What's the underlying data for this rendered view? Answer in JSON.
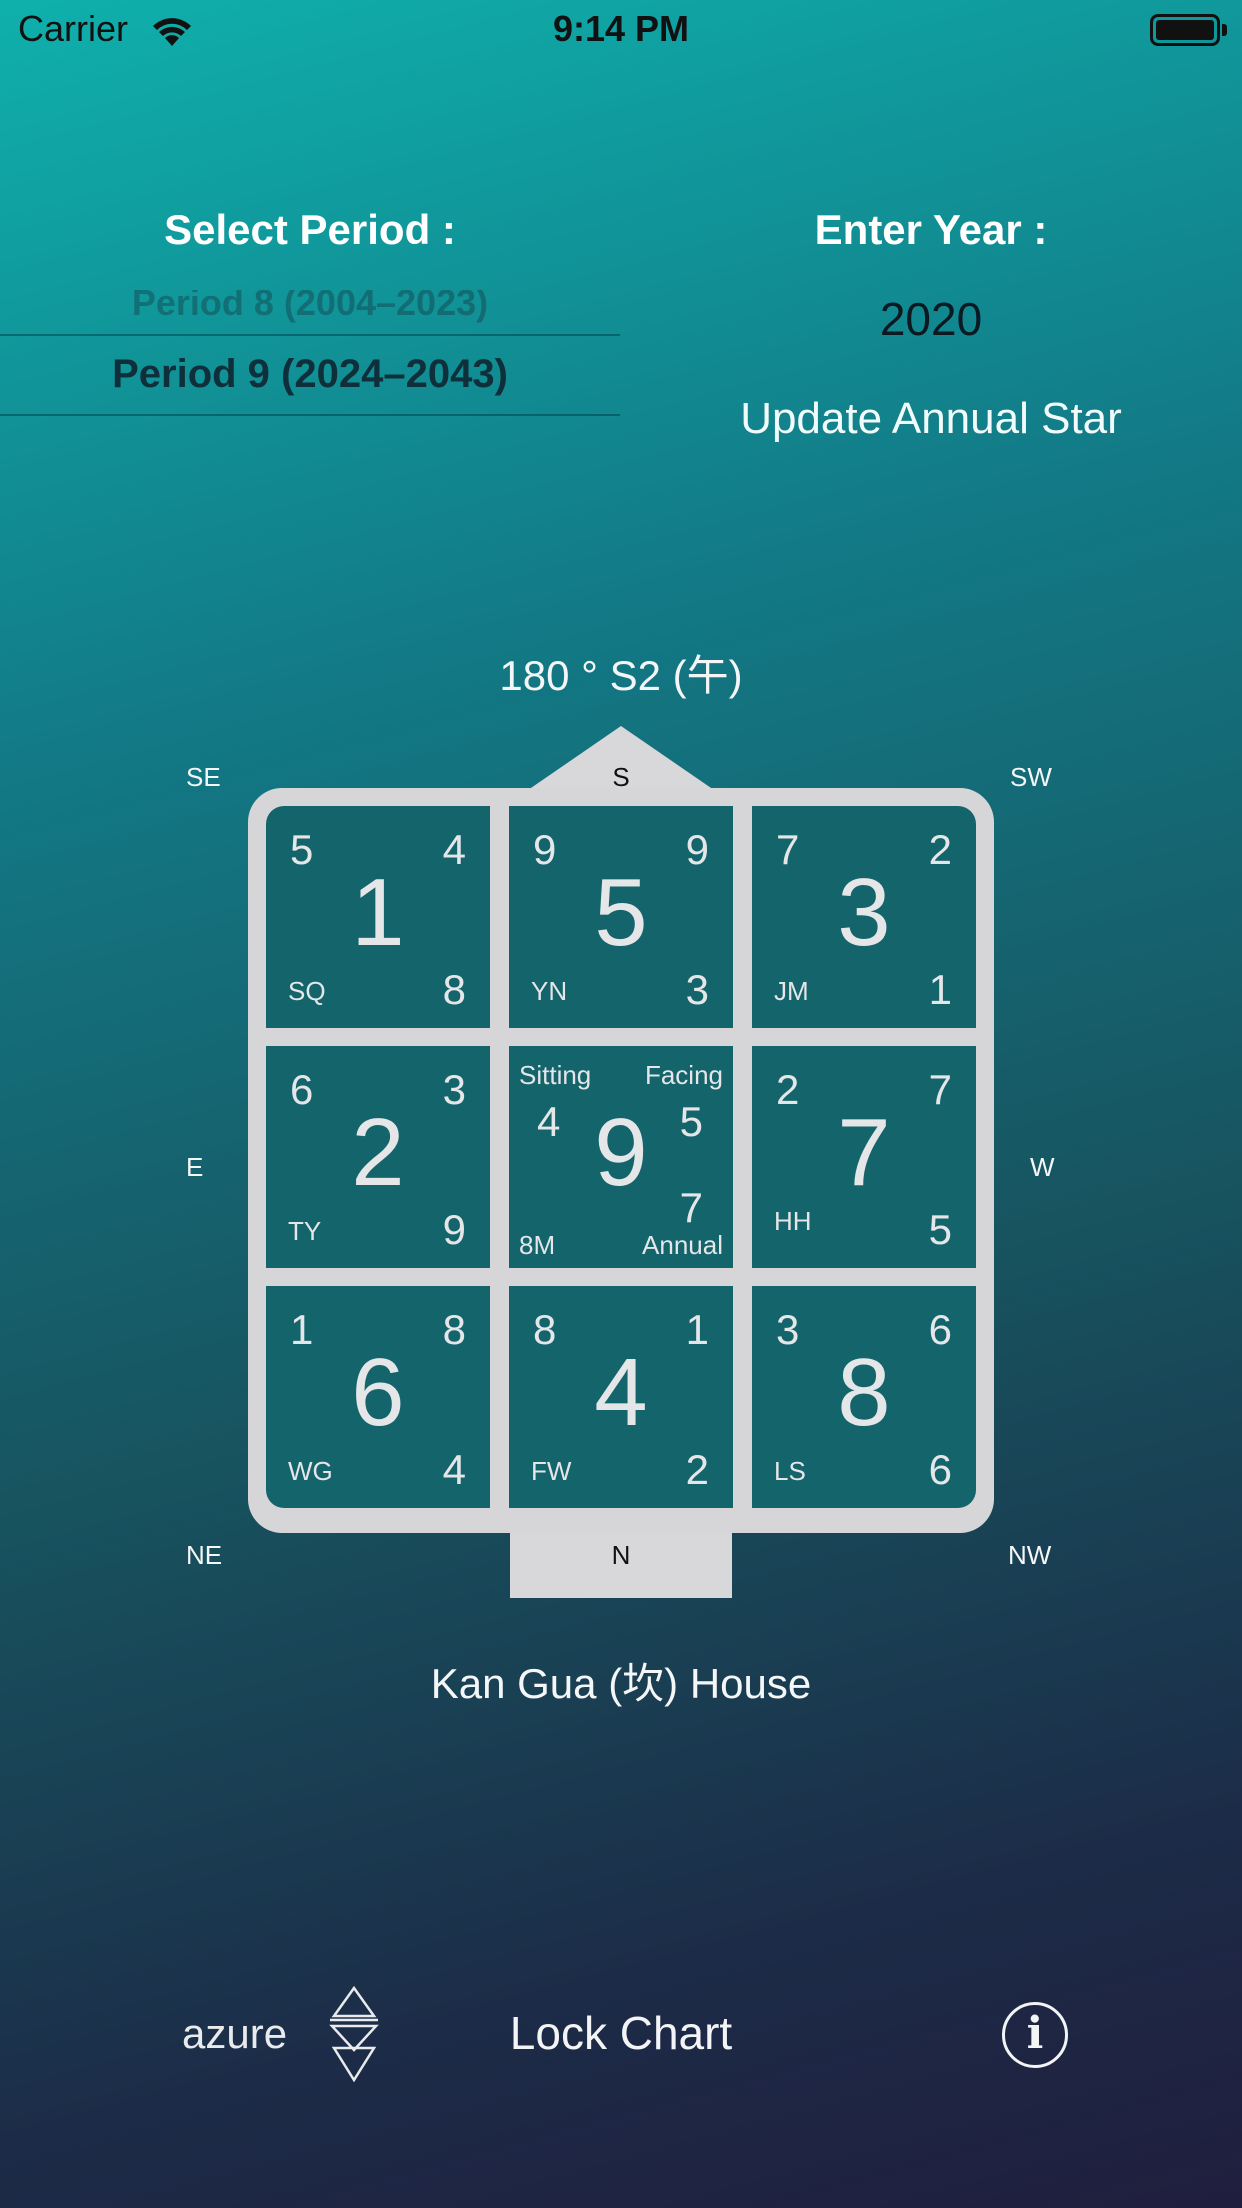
{
  "status_bar": {
    "carrier": "Carrier",
    "time": "9:14 PM",
    "wifi_icon": "wifi-icon",
    "battery_icon": "battery-icon",
    "battery_level": 1.0
  },
  "controls": {
    "select_period_label": "Select Period :",
    "period_picker": {
      "previous_option": "Period 8 (2004–2023)",
      "selected": "Period 9 (2024–2043)"
    },
    "enter_year_label": "Enter Year :",
    "year_value": "2020",
    "update_button": "Update Annual Star"
  },
  "chart": {
    "degree": "180 ° S2 (午)",
    "directions": {
      "top": "S",
      "bottom": "N",
      "left": "E",
      "right": "W",
      "top_left": "SE",
      "top_right": "SW",
      "bottom_left": "NE",
      "bottom_right": "NW"
    },
    "palaces": [
      {
        "tl": "5",
        "tr": "4",
        "center": "1",
        "bl": "SQ",
        "br": "8"
      },
      {
        "tl": "9",
        "tr": "9",
        "center": "5",
        "bl": "YN",
        "br": "3"
      },
      {
        "tl": "7",
        "tr": "2",
        "center": "3",
        "bl": "JM",
        "br": "1"
      },
      {
        "tl": "6",
        "tr": "3",
        "center": "2",
        "bl": "TY",
        "br": "9"
      },
      {
        "sitting_label": "Sitting",
        "facing_label": "Facing",
        "sitting": "4",
        "facing": "5",
        "center": "9",
        "annual": "7",
        "bl": "8M",
        "annual_label": "Annual"
      },
      {
        "tl": "2",
        "tr": "7",
        "center": "7",
        "bl": "HH",
        "br": "5"
      },
      {
        "tl": "1",
        "tr": "8",
        "center": "6",
        "bl": "WG",
        "br": "4"
      },
      {
        "tl": "8",
        "tr": "1",
        "center": "4",
        "bl": "FW",
        "br": "2"
      },
      {
        "tl": "3",
        "tr": "6",
        "center": "8",
        "bl": "LS",
        "br": "6"
      }
    ],
    "house_name": "Kan Gua (坎) House"
  },
  "footer": {
    "brand": "azure",
    "brand_logo_icon": "azure-logo-icon",
    "lock_button": "Lock Chart",
    "info_icon": "info-icon",
    "info_glyph": "i"
  }
}
